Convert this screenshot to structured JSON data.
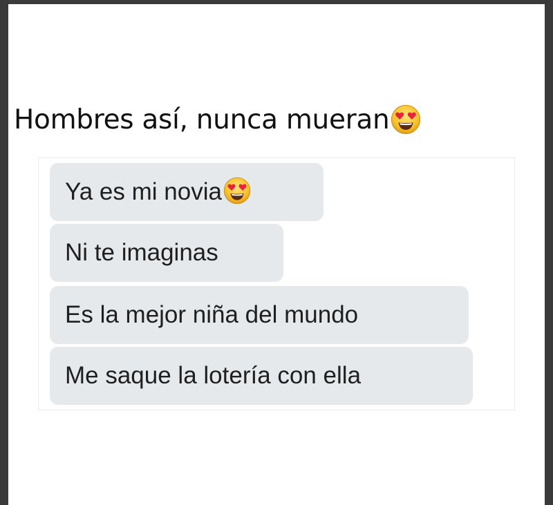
{
  "headline": {
    "text": "Hombres así, nunca mueran",
    "emoji": "heart-eyes-emoji"
  },
  "messages": [
    {
      "text": "Ya es mi novia",
      "emoji": "heart-eyes-emoji"
    },
    {
      "text": "Ni te imaginas"
    },
    {
      "text": "Es la mejor niña del mundo"
    },
    {
      "text": "Me saque la lotería con ella"
    }
  ],
  "colors": {
    "page_background": "#ffffff",
    "border": "#3a3a3a",
    "bubble": "#e5e9ec",
    "text": "#1f1f1f",
    "emoji_face": "#f7c12c",
    "emoji_hearts": "#e8233f"
  }
}
